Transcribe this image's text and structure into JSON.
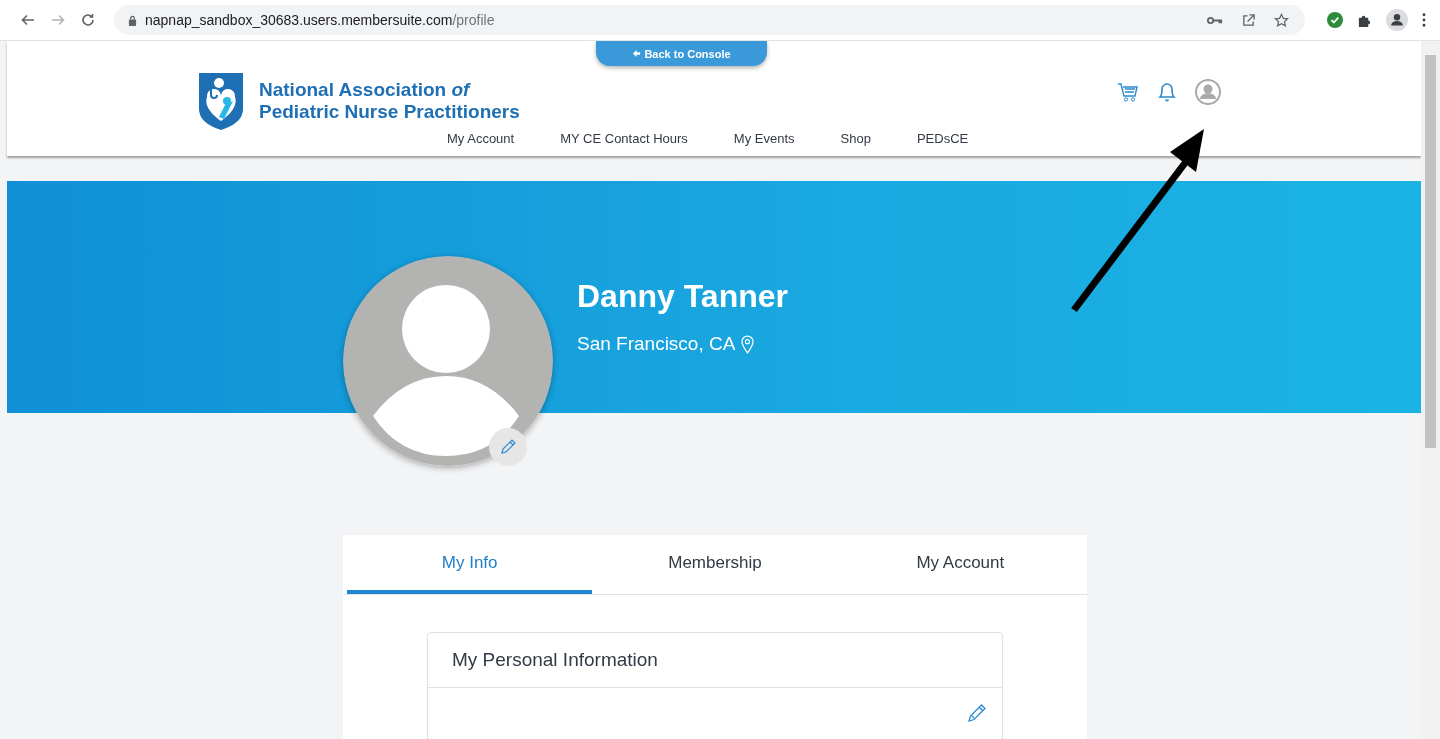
{
  "browser": {
    "url_host": "napnap_sandbox_30683.users.membersuite.com",
    "url_path": "/profile"
  },
  "console_button": "Back to Console",
  "logo": {
    "line1": "National Association *of*",
    "line2": "Pediatric Nurse Practitioners"
  },
  "nav": [
    "My Account",
    "MY CE Contact Hours",
    "My Events",
    "Shop",
    "PEDsCE"
  ],
  "profile": {
    "name": "Danny Tanner",
    "location": "San Francisco, CA"
  },
  "tabs": [
    {
      "label": "My Info",
      "selected": true
    },
    {
      "label": "Membership",
      "selected": false
    },
    {
      "label": "My Account",
      "selected": false
    }
  ],
  "section": {
    "title": "My Personal Information"
  }
}
